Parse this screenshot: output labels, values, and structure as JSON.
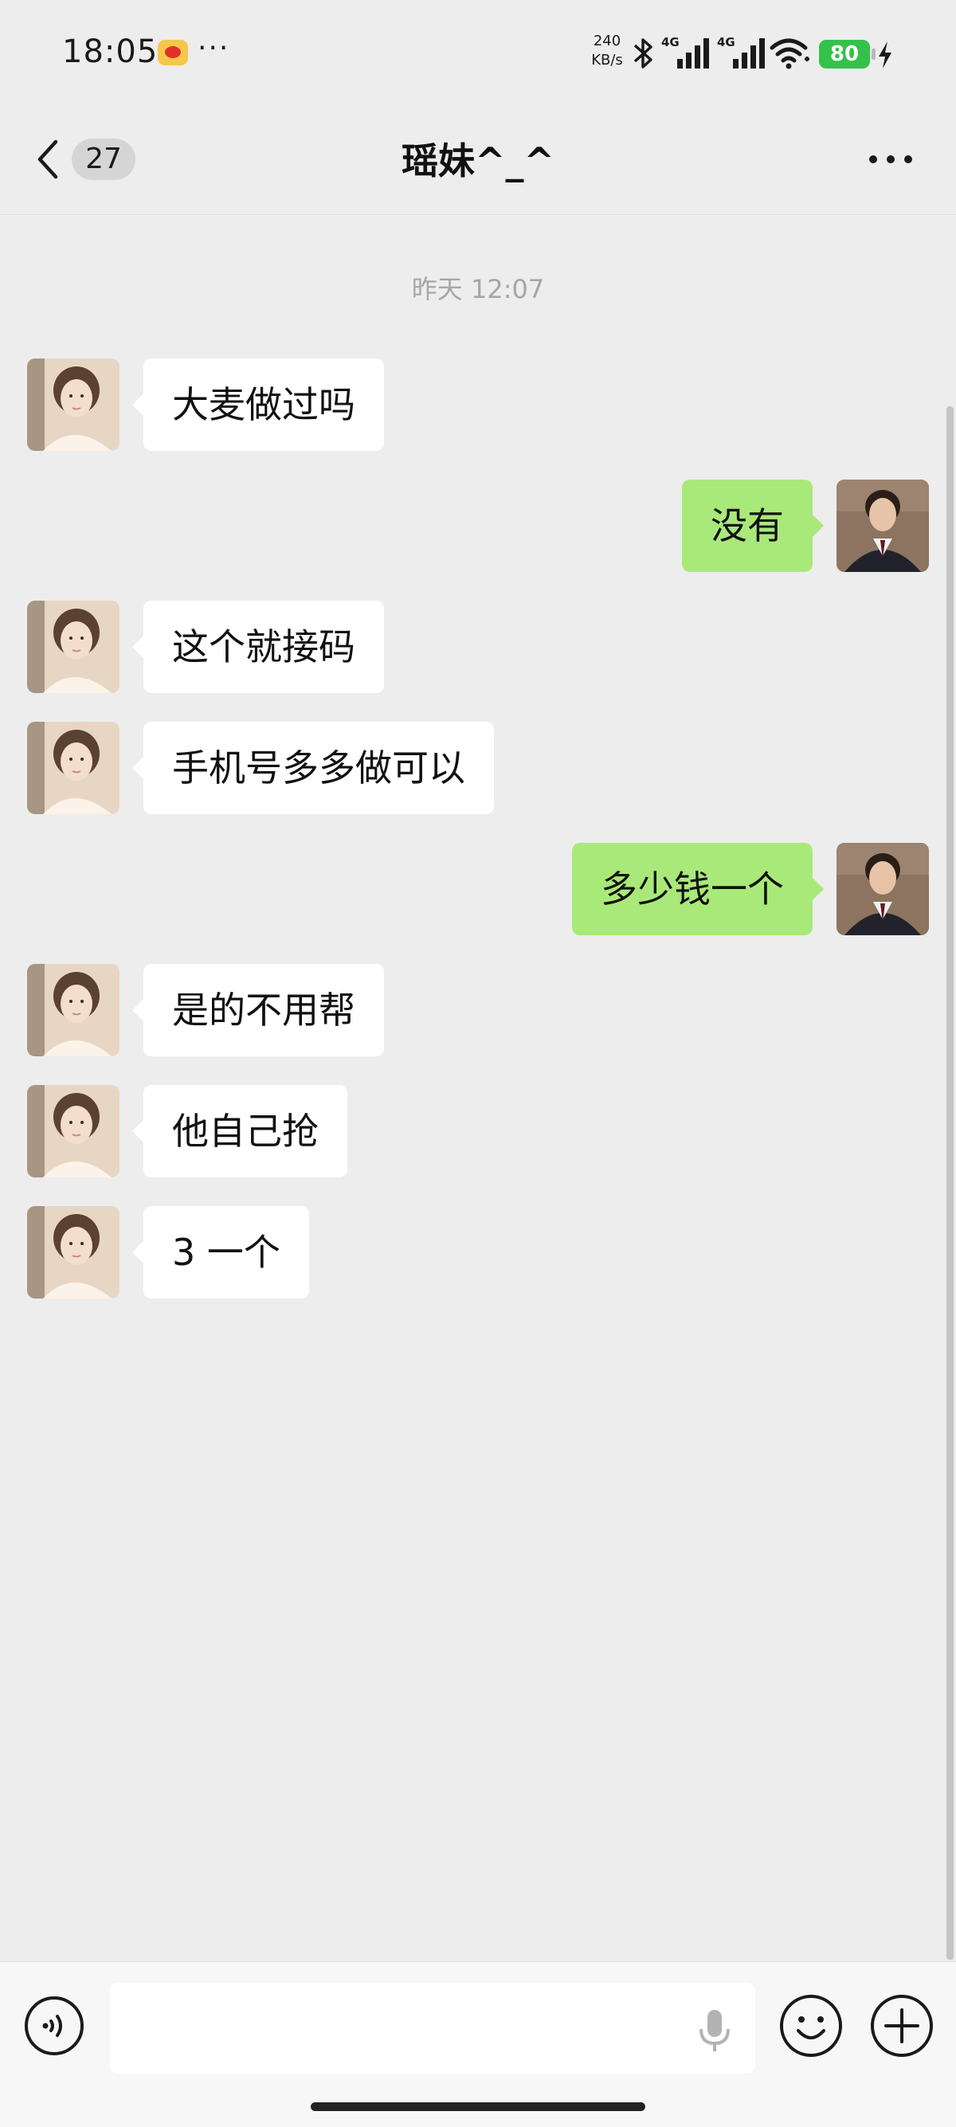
{
  "status_bar": {
    "time": "18:05",
    "dots": "···",
    "net_speed_value": "240",
    "net_speed_unit": "KB/s",
    "signal_1_label": "4G",
    "signal_2_label": "4G",
    "battery": "80",
    "icons": [
      "weibo-icon",
      "bluetooth-icon",
      "signal-icon",
      "wifi-icon",
      "battery-icon",
      "charging-icon"
    ]
  },
  "header": {
    "back_icon": "chevron-left-icon",
    "unread_count": "27",
    "title": "瑶妹^_^",
    "more_icon": "more-horizontal-icon"
  },
  "chat": {
    "timestamp": "昨天 12:07",
    "messages": [
      {
        "side": "left",
        "text": "大麦做过吗"
      },
      {
        "side": "right",
        "text": "没有"
      },
      {
        "side": "left",
        "text": "这个就接码"
      },
      {
        "side": "left",
        "text": "手机号多多做可以"
      },
      {
        "side": "right",
        "text": "多少钱一个"
      },
      {
        "side": "left",
        "text": "是的不用帮"
      },
      {
        "side": "left",
        "text": "他自己抢"
      },
      {
        "side": "left",
        "text": "3 一个"
      }
    ]
  },
  "input_bar": {
    "placeholder": "",
    "icons": [
      "voice-icon",
      "microphone-icon",
      "emoji-icon",
      "plus-icon"
    ]
  },
  "colors": {
    "background": "#ededed",
    "sent_bubble": "#a9e979",
    "received_bubble": "#ffffff",
    "battery": "#35c24a"
  }
}
